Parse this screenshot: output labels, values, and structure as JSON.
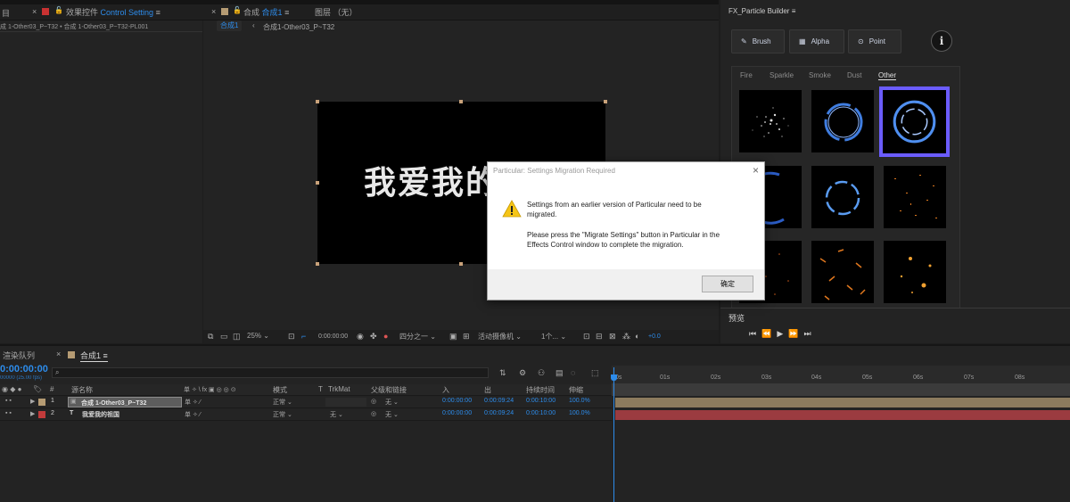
{
  "left_panel": {
    "tab_partial": "目",
    "sub_path": "成 1-Other03_P~T32 • 合成 1-Other03_P~T32-PL001"
  },
  "effects_panel": {
    "tab_label": "效果控件",
    "tab_value": "Control Setting",
    "menu_icon": "hamburger-icon"
  },
  "comp_panel": {
    "tab_label": "合成",
    "tab_value": "合成1",
    "layer_tab": "图层 （无）",
    "breadcrumb_active": "合成1",
    "breadcrumb_next": "合成1-Other03_P~T32",
    "canvas_text": "我爱我的"
  },
  "viewer_toolbar": {
    "zoom": "25%",
    "timecode": "0:00:00:00",
    "resolution": "四分之一",
    "camera": "活动摄像机",
    "views": "1个...",
    "exposure": "+0.0"
  },
  "particle_builder": {
    "title": "FX_Particle Builder",
    "buttons": [
      "Brush",
      "Alpha",
      "Point"
    ],
    "info_icon": "info-icon",
    "tabs": [
      "Fire",
      "Sparkle",
      "Smoke",
      "Dust",
      "Other"
    ],
    "active_tab": "Other",
    "accent": "#6b5cff"
  },
  "preview": {
    "label": "预览"
  },
  "dialog": {
    "title": "Particular: Settings Migration Required",
    "line1": "Settings from an earlier version of Particular need to be",
    "line2": "migrated.",
    "line3": "Please press the \"Migrate Settings\" button in Particular in the",
    "line4": "Effects Control window to complete the migration.",
    "ok": "确定"
  },
  "timeline": {
    "tab_render": "渲染队列",
    "tab_comp": "合成1",
    "timecode": "0:00:00:00",
    "fps": "00000 (25.00 fps)",
    "columns": {
      "num": "#",
      "name": "源名称",
      "switches": "单 ✧ \\ fx ▣ ◎ ◎ ⊙",
      "mode": "模式",
      "t": "T",
      "trkmat": "TrkMat",
      "parent": "父级和链接",
      "in": "入",
      "out": "出",
      "duration": "持续时间",
      "stretch": "伸缩"
    },
    "ruler": [
      "0s",
      "01s",
      "02s",
      "03s",
      "04s",
      "05s",
      "06s",
      "07s",
      "08s"
    ],
    "layers": [
      {
        "num": "1",
        "name": "合成 1-Other03_P~T32",
        "mode": "正常",
        "trkmat": "",
        "parent": "无",
        "in": "0:00:00:00",
        "out": "0:00:09:24",
        "duration": "0:00:10:00",
        "stretch": "100.0%",
        "color": "#b59b73"
      },
      {
        "num": "2",
        "name": "我爱我的祖国",
        "mode": "正常",
        "trkmat": "无",
        "parent": "无",
        "in": "0:00:00:00",
        "out": "0:00:09:24",
        "duration": "0:00:10:00",
        "stretch": "100.0%",
        "color": "#c23b3b"
      }
    ]
  }
}
